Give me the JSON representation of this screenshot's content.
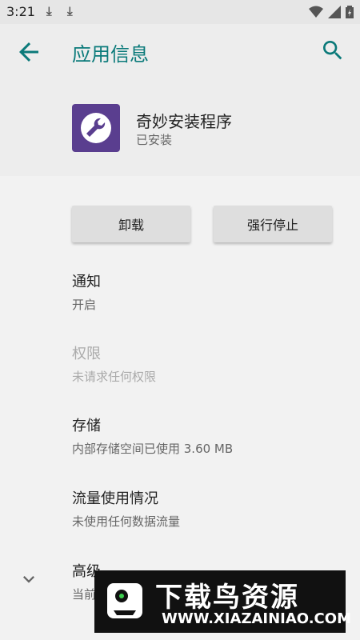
{
  "status_bar": {
    "time": "3:21",
    "download_icons": [
      "download-icon",
      "download-icon"
    ],
    "right_icons": [
      "wifi-icon",
      "signal-icon",
      "battery-icon"
    ]
  },
  "app_bar": {
    "title": "应用信息",
    "back_icon": "arrow-back-icon",
    "search_icon": "search-icon"
  },
  "app": {
    "name": "奇妙安装程序",
    "status": "已安装",
    "icon": "wrench-icon",
    "icon_bg": "#5a3e8f"
  },
  "buttons": {
    "uninstall": "卸载",
    "force_stop": "强行停止"
  },
  "settings": [
    {
      "title": "通知",
      "subtitle": "开启",
      "enabled": true
    },
    {
      "title": "权限",
      "subtitle": "未请求任何权限",
      "enabled": false
    },
    {
      "title": "存储",
      "subtitle": "内部存储空间已使用 3.60 MB",
      "enabled": true
    },
    {
      "title": "流量使用情况",
      "subtitle": "未使用任何数据流量",
      "enabled": true
    },
    {
      "title": "高级",
      "subtitle": "当前",
      "enabled": true
    }
  ],
  "watermark": {
    "title": "下载鸟资源",
    "url": "WWW.XIAZAINIAO.COM"
  },
  "colors": {
    "accent": "#0b7a7a",
    "background": "#f2f2f2"
  }
}
